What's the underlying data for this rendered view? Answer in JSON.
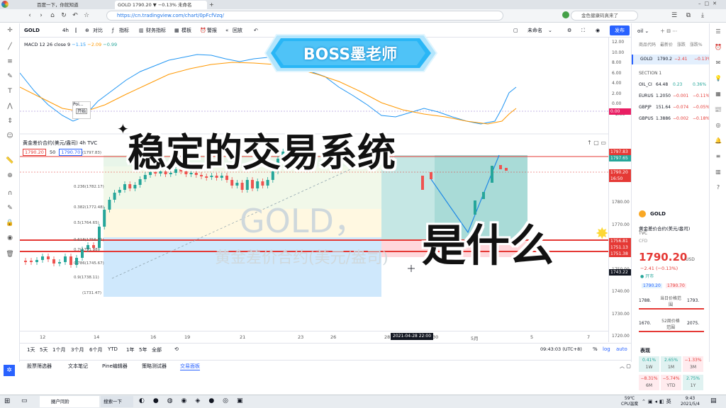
{
  "browser": {
    "tabs": [
      "百度一下，你就知道",
      "GOLD 1790.20 ▼ −0.13% 未命名"
    ],
    "url": "https://cn.tradingview.com/chart/0pFcfVzq/",
    "search_placeholder": "金色健康码真来了"
  },
  "toolbar": {
    "symbol": "GOLD",
    "interval": "4h",
    "compare": "对比",
    "indicators": "指标",
    "financials": "财务指标",
    "templates": "模板",
    "alert": "警报",
    "replay": "回放",
    "layout_name": "未命名",
    "publish": "发布"
  },
  "macd": {
    "label": "MACD 12 26 close 9",
    "v1": "−1.15",
    "v2": "−2.09",
    "v3": "−0.99",
    "axis": [
      "12.00",
      "10.00",
      "8.00",
      "6.00",
      "4.00",
      "2.00",
      "0.00",
      "−2.00"
    ],
    "tag": "0.00"
  },
  "main": {
    "title": "黄金差价合约(美元/盎司)",
    "interval": "4h",
    "exchange": "TVC",
    "ohlc": "1770.20 收−1773.71 +0.04 (+0.00%)",
    "price_box_sell": "1790.20",
    "spread": "50",
    "price_box_buy": "1790.70",
    "watermark_symbol": "GOLD，",
    "watermark_name": "黄金差价合约(美元/盎司)",
    "fib_levels": [
      "(1797.83)",
      "0.236(1782.17)",
      "0.382(1772.48)",
      "0.5(1764.65)",
      "0.618(1756.81)",
      "0.7(1751.38)",
      "0.786(1745.67)",
      "0.9(1738.11)",
      "(1731.47)"
    ],
    "axis": [
      "1800.00",
      "1790.00",
      "1780.00",
      "1770.00",
      "1760.00",
      "1750.00",
      "1740.00",
      "1730.00",
      "1720.00"
    ],
    "tags": [
      {
        "text": "1797.83",
        "color": "#e53935"
      },
      {
        "text": "1797.65",
        "color": "#26a69a"
      },
      {
        "text": "1790.20",
        "color": "#e53935"
      },
      {
        "text": "16:50",
        "color": "#e53935"
      },
      {
        "text": "1756.81",
        "color": "#e53935"
      },
      {
        "text": "1751.13",
        "color": "#e53935"
      },
      {
        "text": "1751.38",
        "color": "#e53935"
      },
      {
        "text": "1743.22",
        "color": "#131722"
      }
    ],
    "popup_label": "Poi...",
    "popup_btn": "开始",
    "time_labels": [
      "12",
      "14",
      "16",
      "19",
      "21",
      "23",
      "26",
      "28",
      "30",
      "5月",
      "5",
      "7"
    ],
    "time_highlight": "2021-04-28  22:00"
  },
  "bottom": {
    "ranges": [
      "1天",
      "5天",
      "1个月",
      "3个月",
      "6个月",
      "YTD",
      "1年",
      "5年",
      "全部"
    ],
    "clock": "09:43:03 (UTC+8)",
    "pct": "%",
    "log": "log",
    "auto": "auto"
  },
  "panel_tabs": [
    "股票筛选器",
    "文本笔记",
    "Pine编辑器",
    "策略测试器",
    "交易面板"
  ],
  "watchlist": {
    "header": "oil",
    "cols": [
      "商品代码",
      "最新价",
      "涨跌",
      "涨跌%"
    ],
    "rows": [
      {
        "sym": "GOLD",
        "last": "1790.2",
        "chg": "−2.41",
        "pct": "−0.13%",
        "color": "#e53935"
      },
      {
        "section": "SECTION 1"
      },
      {
        "sym": "OIL_CI",
        "last": "64.48",
        "chg": "0.23",
        "pct": "0.36%",
        "color": "#26a69a"
      },
      {
        "sym": "EURUS",
        "last": "1.2050",
        "chg": "−0.001",
        "pct": "−0.11%",
        "color": "#e53935"
      },
      {
        "sym": "GBPJP",
        "last": "151.64",
        "chg": "−0.074",
        "pct": "−0.05%",
        "color": "#e53935"
      },
      {
        "sym": "GBPUS",
        "last": "1.3886",
        "chg": "−0.002",
        "pct": "−0.18%",
        "color": "#e53935"
      }
    ]
  },
  "details": {
    "symbol": "GOLD",
    "name": "黄金差价合约(美元/盎司)",
    "exchange": "TVC",
    "type": "CFD",
    "price": "1790.20",
    "currency": "USD",
    "change": "−2.41 (−0.13%)",
    "status": "● 开市",
    "bid": "1790.20",
    "ask": "1790.70",
    "range_low": "1788.",
    "range_label": "当日价格范围",
    "range_high": "1793.",
    "range52_low": "1670.",
    "range52_label": "52周价格范围",
    "range52_high": "2075.",
    "perf_title": "表现",
    "perf": [
      {
        "v": "0.41%",
        "l": "1W",
        "c": "#26a69a"
      },
      {
        "v": "2.65%",
        "l": "1M",
        "c": "#26a69a"
      },
      {
        "v": "−1.33%",
        "l": "3M",
        "c": "#e53935"
      },
      {
        "v": "−8.31%",
        "l": "6M",
        "c": "#e53935"
      },
      {
        "v": "−5.74%",
        "l": "YTD",
        "c": "#e53935"
      },
      {
        "v": "2.75%",
        "l": "1Y",
        "c": "#26a69a"
      }
    ]
  },
  "overlay": {
    "banner": "BOSS墨老师",
    "title_line1": "稳定的交易系统",
    "title_line2": "是什么"
  },
  "taskbar": {
    "start_item": "圈户同阶",
    "search_item": "搜索一下",
    "temp": "59℃",
    "cpu": "CPU温度",
    "time": "9:43",
    "date": "2021/5/4"
  }
}
